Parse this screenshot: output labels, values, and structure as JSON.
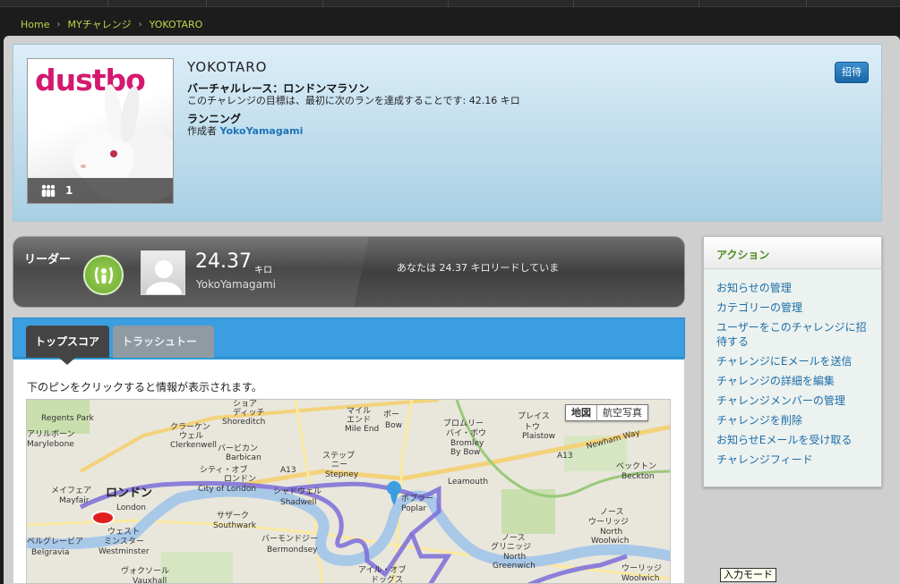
{
  "breadcrumb": {
    "home": "Home",
    "my_challenge": "MYチャレンジ",
    "current": "YOKOTARO",
    "sep": "›"
  },
  "challenge": {
    "logo_text": "dustbo",
    "member_count": "1",
    "title": "YOKOTARO",
    "subtitle": "バーチャルレース：ロンドンマラソン",
    "description": "このチャレンジの目標は、最初に次のランを達成することです: 42.16 キロ",
    "activity": "ランニング",
    "author_prefix": "作成者",
    "author_name": "YokoYamagami",
    "invite_label": "招待"
  },
  "leader": {
    "label": "リーダー",
    "score": "24.37",
    "unit": "キロ",
    "name": "YokoYamagami",
    "lead_text": "あなたは 24.37 キロリードしていま"
  },
  "tabs": {
    "top_score": "トップスコア",
    "trash_talk": "トラッシュトーク"
  },
  "content": {
    "hint": "下のピンをクリックすると情報が表示されます。"
  },
  "map": {
    "type_map": "地図",
    "type_satellite": "航空写真",
    "labels": [
      {
        "t": "Regents Park"
      },
      {
        "t": "アリルボーン"
      },
      {
        "t": "Marylebone"
      },
      {
        "t": "クラーケン"
      },
      {
        "t": "ウェル"
      },
      {
        "t": "Clerkenwell"
      },
      {
        "t": "ショア"
      },
      {
        "t": "ディッチ"
      },
      {
        "t": "Shoreditch"
      },
      {
        "t": "マイル"
      },
      {
        "t": "エンド"
      },
      {
        "t": "Mile End"
      },
      {
        "t": "ボー"
      },
      {
        "t": "Bow"
      },
      {
        "t": "ブロムリー"
      },
      {
        "t": "バイ・ボウ"
      },
      {
        "t": "Bromley"
      },
      {
        "t": "By Bow"
      },
      {
        "t": "プレイス"
      },
      {
        "t": "トウ"
      },
      {
        "t": "Plaistow"
      },
      {
        "t": "バービカン"
      },
      {
        "t": "Barbican"
      },
      {
        "t": "シティ・オブ"
      },
      {
        "t": "ロンドン"
      },
      {
        "t": "City of London"
      },
      {
        "t": "ステップ"
      },
      {
        "t": "ニー"
      },
      {
        "t": "Stepney"
      },
      {
        "t": "メイフェア"
      },
      {
        "t": "Mayfair"
      },
      {
        "t": "ロンドン"
      },
      {
        "t": "London"
      },
      {
        "t": "シャドウェル"
      },
      {
        "t": "Shadwell"
      },
      {
        "t": "Leamouth"
      },
      {
        "t": "ポプラー"
      },
      {
        "t": "Poplar"
      },
      {
        "t": "ベックトン"
      },
      {
        "t": "Beckton"
      },
      {
        "t": "ベルグレービア"
      },
      {
        "t": "Belgravia"
      },
      {
        "t": "ウェスト"
      },
      {
        "t": "ミンスター"
      },
      {
        "t": "Westminster"
      },
      {
        "t": "サザーク"
      },
      {
        "t": "Southwark"
      },
      {
        "t": "バーモンドジー"
      },
      {
        "t": "Bermondsey"
      },
      {
        "t": "ノース"
      },
      {
        "t": "ウーリッジ"
      },
      {
        "t": "North"
      },
      {
        "t": "Woolwich"
      },
      {
        "t": "ノース"
      },
      {
        "t": "グリニッジ"
      },
      {
        "t": "North"
      },
      {
        "t": "Greenwich"
      },
      {
        "t": "ヴォクソール"
      },
      {
        "t": "Vauxhall"
      },
      {
        "t": "アイル・オブ"
      },
      {
        "t": "ドッグス"
      },
      {
        "t": "ウーリッジ"
      },
      {
        "t": "Woolwich"
      },
      {
        "t": "A13"
      },
      {
        "t": "A13"
      },
      {
        "t": "Newham Way"
      }
    ]
  },
  "sidebar": {
    "title": "アクション",
    "items": [
      "お知らせの管理",
      "カテゴリーの管理",
      "ユーザーをこのチャレンジに招待する",
      "チャレンジにEメールを送信",
      "チャレンジの詳細を編集",
      "チャレンジメンバーの管理",
      "チャレンジを削除",
      "お知らせEメールを受け取る",
      "チャレンジフィード"
    ]
  },
  "ime_mode": "入力モード",
  "colors": {
    "accent_blue": "#3a9ee0",
    "link": "#1c6da8",
    "green": "#4c8d1e",
    "breadcrumb": "#b9d84a",
    "logo_pink": "#d5186f",
    "route": "#7a6cd8"
  }
}
